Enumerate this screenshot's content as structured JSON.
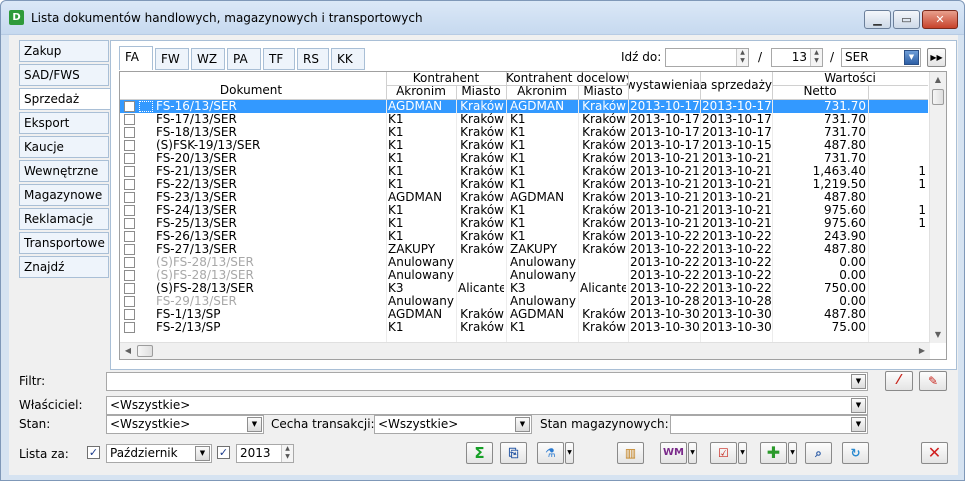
{
  "window": {
    "title": "Lista dokumentów handlowych, magazynowych i transportowych",
    "app_icon": "D"
  },
  "sidebar": {
    "items": [
      {
        "label": "Zakup"
      },
      {
        "label": "SAD/FWS"
      },
      {
        "label": "Sprzedaż"
      },
      {
        "label": "Eksport"
      },
      {
        "label": "Kaucje"
      },
      {
        "label": "Wewnętrzne"
      },
      {
        "label": "Magazynowe"
      },
      {
        "label": "Reklamacje"
      },
      {
        "label": "Transportowe"
      },
      {
        "label": "Znajdź"
      }
    ],
    "active_index": 2
  },
  "doc_tabs": {
    "items": [
      "FA",
      "FW",
      "WZ",
      "PA",
      "TF",
      "RS",
      "KK"
    ],
    "active_index": 0
  },
  "goto": {
    "label": "Idź do:",
    "field1": "",
    "sep1": "/",
    "number": "13",
    "sep2": "/",
    "series": "SER"
  },
  "grid": {
    "headers": {
      "dokument": "Dokument",
      "kontrahent": "Kontrahent",
      "kontrahent_docelowy": "Kontrahent docelowy",
      "akronim": "Akronim",
      "miasto": "Miasto",
      "akronim2": "Akronim",
      "miasto2": "Miasto",
      "wystawienia": "Data wystawienia",
      "sprzedazy": "Data sprzedaży",
      "wartosci": "Wartości",
      "netto": "Netto"
    },
    "rows": [
      {
        "doc": "FS-16/13/SER",
        "akr": "AGDMAN",
        "miasto": "Kraków",
        "akr2": "AGDMAN",
        "miasto2": "Kraków",
        "wyst": "2013-10-17",
        "sprz": "2013-10-17",
        "netto": "731.70",
        "extra": "",
        "state": "selected"
      },
      {
        "doc": "FS-17/13/SER",
        "akr": "K1",
        "miasto": "Kraków",
        "akr2": "K1",
        "miasto2": "Kraków",
        "wyst": "2013-10-17",
        "sprz": "2013-10-17",
        "netto": "731.70",
        "extra": "",
        "state": "normal"
      },
      {
        "doc": "FS-18/13/SER",
        "akr": "K1",
        "miasto": "Kraków",
        "akr2": "K1",
        "miasto2": "Kraków",
        "wyst": "2013-10-17",
        "sprz": "2013-10-17",
        "netto": "731.70",
        "extra": "",
        "state": "normal"
      },
      {
        "doc": "(S)FSK-19/13/SER",
        "akr": "K1",
        "miasto": "Kraków",
        "akr2": "K1",
        "miasto2": "Kraków",
        "wyst": "2013-10-17",
        "sprz": "2013-10-15",
        "netto": "487.80",
        "extra": "",
        "state": "normal"
      },
      {
        "doc": "FS-20/13/SER",
        "akr": "K1",
        "miasto": "Kraków",
        "akr2": "K1",
        "miasto2": "Kraków",
        "wyst": "2013-10-21",
        "sprz": "2013-10-21",
        "netto": "731.70",
        "extra": "",
        "state": "normal"
      },
      {
        "doc": "FS-21/13/SER",
        "akr": "K1",
        "miasto": "Kraków",
        "akr2": "K1",
        "miasto2": "Kraków",
        "wyst": "2013-10-21",
        "sprz": "2013-10-21",
        "netto": "1,463.40",
        "extra": "1",
        "state": "normal"
      },
      {
        "doc": "FS-22/13/SER",
        "akr": "K1",
        "miasto": "Kraków",
        "akr2": "K1",
        "miasto2": "Kraków",
        "wyst": "2013-10-21",
        "sprz": "2013-10-21",
        "netto": "1,219.50",
        "extra": "1",
        "state": "normal"
      },
      {
        "doc": "FS-23/13/SER",
        "akr": "AGDMAN",
        "miasto": "Kraków",
        "akr2": "AGDMAN",
        "miasto2": "Kraków",
        "wyst": "2013-10-21",
        "sprz": "2013-10-21",
        "netto": "487.80",
        "extra": "",
        "state": "normal"
      },
      {
        "doc": "FS-24/13/SER",
        "akr": "K1",
        "miasto": "Kraków",
        "akr2": "K1",
        "miasto2": "Kraków",
        "wyst": "2013-10-21",
        "sprz": "2013-10-21",
        "netto": "975.60",
        "extra": "1",
        "state": "normal"
      },
      {
        "doc": "FS-25/13/SER",
        "akr": "K1",
        "miasto": "Kraków",
        "akr2": "K1",
        "miasto2": "Kraków",
        "wyst": "2013-10-21",
        "sprz": "2013-10-21",
        "netto": "975.60",
        "extra": "1",
        "state": "normal"
      },
      {
        "doc": "FS-26/13/SER",
        "akr": "K1",
        "miasto": "Kraków",
        "akr2": "K1",
        "miasto2": "Kraków",
        "wyst": "2013-10-22",
        "sprz": "2013-10-22",
        "netto": "243.90",
        "extra": "",
        "state": "normal"
      },
      {
        "doc": "FS-27/13/SER",
        "akr": "ZAKUPY",
        "miasto": "Kraków",
        "akr2": "ZAKUPY",
        "miasto2": "Kraków",
        "wyst": "2013-10-22",
        "sprz": "2013-10-22",
        "netto": "487.80",
        "extra": "",
        "state": "normal"
      },
      {
        "doc": "(S)FS-28/13/SER",
        "akr": "Anulowany",
        "miasto": "",
        "akr2": "Anulowany",
        "miasto2": "",
        "wyst": "2013-10-22",
        "sprz": "2013-10-22",
        "netto": "0.00",
        "extra": "",
        "state": "grey-doc"
      },
      {
        "doc": "(S)FS-28/13/SER",
        "akr": "Anulowany",
        "miasto": "",
        "akr2": "Anulowany",
        "miasto2": "",
        "wyst": "2013-10-22",
        "sprz": "2013-10-22",
        "netto": "0.00",
        "extra": "",
        "state": "grey-doc"
      },
      {
        "doc": "(S)FS-28/13/SER",
        "akr": "K3",
        "miasto": "Alicante",
        "akr2": "K3",
        "miasto2": "Alicante",
        "wyst": "2013-10-22",
        "sprz": "2013-10-22",
        "netto": "750.00",
        "extra": "",
        "state": "normal"
      },
      {
        "doc": "FS-29/13/SER",
        "akr": "Anulowany",
        "miasto": "",
        "akr2": "Anulowany",
        "miasto2": "",
        "wyst": "2013-10-28",
        "sprz": "2013-10-28",
        "netto": "0.00",
        "extra": "",
        "state": "grey-doc"
      },
      {
        "doc": "FS-1/13/SP",
        "akr": "AGDMAN",
        "miasto": "Kraków",
        "akr2": "AGDMAN",
        "miasto2": "Kraków",
        "wyst": "2013-10-30",
        "sprz": "2013-10-30",
        "netto": "487.80",
        "extra": "",
        "state": "normal"
      },
      {
        "doc": "FS-2/13/SP",
        "akr": "K1",
        "miasto": "Kraków",
        "akr2": "K1",
        "miasto2": "Kraków",
        "wyst": "2013-10-30",
        "sprz": "2013-10-30",
        "netto": "75.00",
        "extra": "",
        "state": "normal"
      }
    ]
  },
  "filters": {
    "filtr_label": "Filtr:",
    "filtr_value": "",
    "wlasciciel_label": "Właściciel:",
    "wlasciciel_value": "<Wszystkie>",
    "stan_label": "Stan:",
    "stan_value": "<Wszystkie>",
    "cecha_label": "Cecha transakcji:",
    "cecha_value": "<Wszystkie>",
    "stan_mag_label": "Stan magazynowych:",
    "stan_mag_value": "",
    "lista_label": "Lista za:",
    "month": "Październik",
    "year": "2013"
  },
  "toolbar": {
    "sum_glyph": "Σ",
    "wm_glyph": "WM"
  },
  "colors": {
    "selected_row": "#3399ff",
    "window_frame": "#d6e3f1",
    "close_red": "#c7432c"
  }
}
